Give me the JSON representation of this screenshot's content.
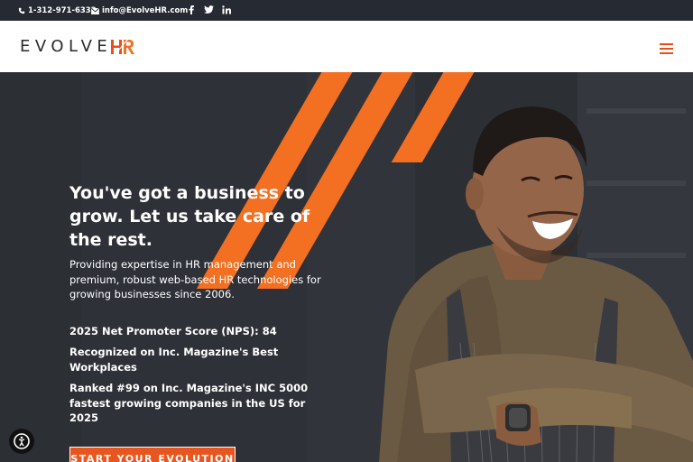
{
  "topbar": {
    "phone": "1-312-971-6332",
    "email": "info@EvolveHR.com",
    "social": [
      "facebook-icon",
      "twitter-icon",
      "linkedin-icon"
    ]
  },
  "header": {
    "logo_word": "EVOLVE",
    "logo_mark": "HR"
  },
  "hero": {
    "headline": "You've got a business to grow. Let us take care of the rest.",
    "subtext": "Providing expertise in HR management and premium, robust web-based HR technologies for growing businesses since 2006.",
    "stats": [
      "2025 Net Promoter Score (NPS): 84",
      "Recognized on Inc. Magazine's Best Workplaces",
      "Ranked #99 on Inc. Magazine's INC 5000 fastest growing companies in the US for 2025"
    ],
    "cta_label": "START YOUR EVOLUTION"
  },
  "colors": {
    "accent": "#f36f21",
    "topbar_bg": "#262a33",
    "hero_bg": "#2b2d33"
  }
}
